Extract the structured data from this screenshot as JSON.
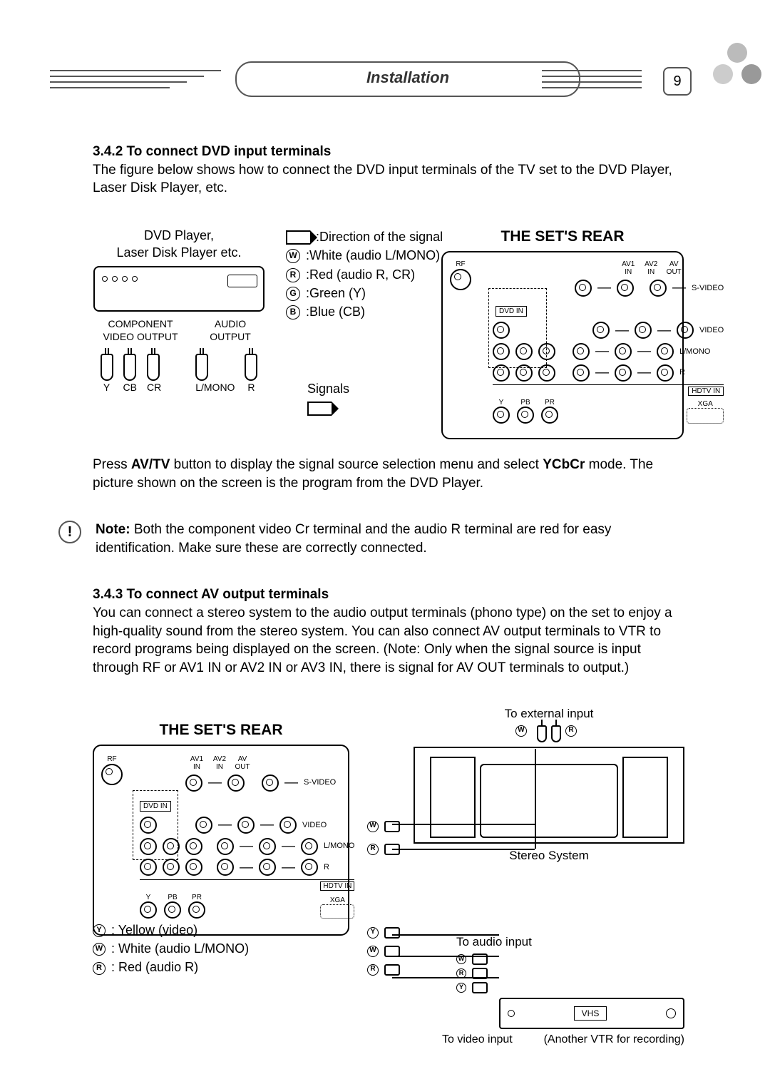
{
  "header": {
    "title": "Installation",
    "page_number": "9"
  },
  "section1": {
    "heading": "3.4.2 To connect DVD input terminals",
    "body": "The figure below shows how to connect the DVD input terminals of the TV set to the DVD Player, Laser Disk Player, etc."
  },
  "fig1": {
    "device_label": "DVD Player,\nLaser Disk Player etc.",
    "direction_label": "Direction of the signal",
    "legend": {
      "w": "White (audio L/MONO)",
      "r": "Red (audio R, CR)",
      "g": "Green (Y)",
      "b": "Blue (CB)"
    },
    "component_label": "COMPONENT VIDEO OUTPUT",
    "audio_label": "AUDIO OUTPUT",
    "plug_labels": {
      "y": "Y",
      "cb": "CB",
      "cr": "CR",
      "lmono": "L/MONO",
      "r": "R"
    },
    "signals_label": "Signals",
    "rear_title": "THE SET'S REAR",
    "rear": {
      "rf": "RF",
      "av1": "AV1 IN",
      "av2": "AV2 IN",
      "avout": "AV OUT",
      "svideo": "S-VIDEO",
      "dvdin": "DVD IN",
      "video": "VIDEO",
      "lmono": "L/MONO",
      "r": "R",
      "hdtvin": "HDTV IN",
      "xga": "XGA",
      "y": "Y",
      "pb": "PB",
      "pr": "PR"
    }
  },
  "instr": {
    "text_lead": "Press ",
    "btn1": "AV/TV",
    "text_mid": " button to display the signal source selection menu and select ",
    "btn2": "YCbCr",
    "text_tail": " mode. The picture shown on the screen is the program from the DVD Player."
  },
  "note": {
    "label": "Note:",
    "text": " Both the component video Cr terminal and the audio R terminal are red for easy identification. Make sure these are correctly connected."
  },
  "section2": {
    "heading": "3.4.3 To connect AV output terminals",
    "body": "You can connect a stereo system to the audio output terminals (phono type) on the set to enjoy a high-quality sound from the stereo system. You can also connect AV output terminals to VTR to record programs being displayed on the screen. (Note: Only when the signal source is input through RF or AV1 IN or AV2 IN or AV3 IN, there is signal for AV OUT terminals to output.)"
  },
  "fig2": {
    "rear_title": "THE SET'S REAR",
    "to_external": "To external input",
    "stereo_label": "Stereo System",
    "to_audio": "To audio input",
    "to_video": "To video input",
    "vhs": "VHS",
    "vtr_label": "(Another VTR for recording)",
    "legend": {
      "y": "Yellow (video)",
      "w": "White (audio L/MONO)",
      "r": "Red (audio R)"
    }
  }
}
